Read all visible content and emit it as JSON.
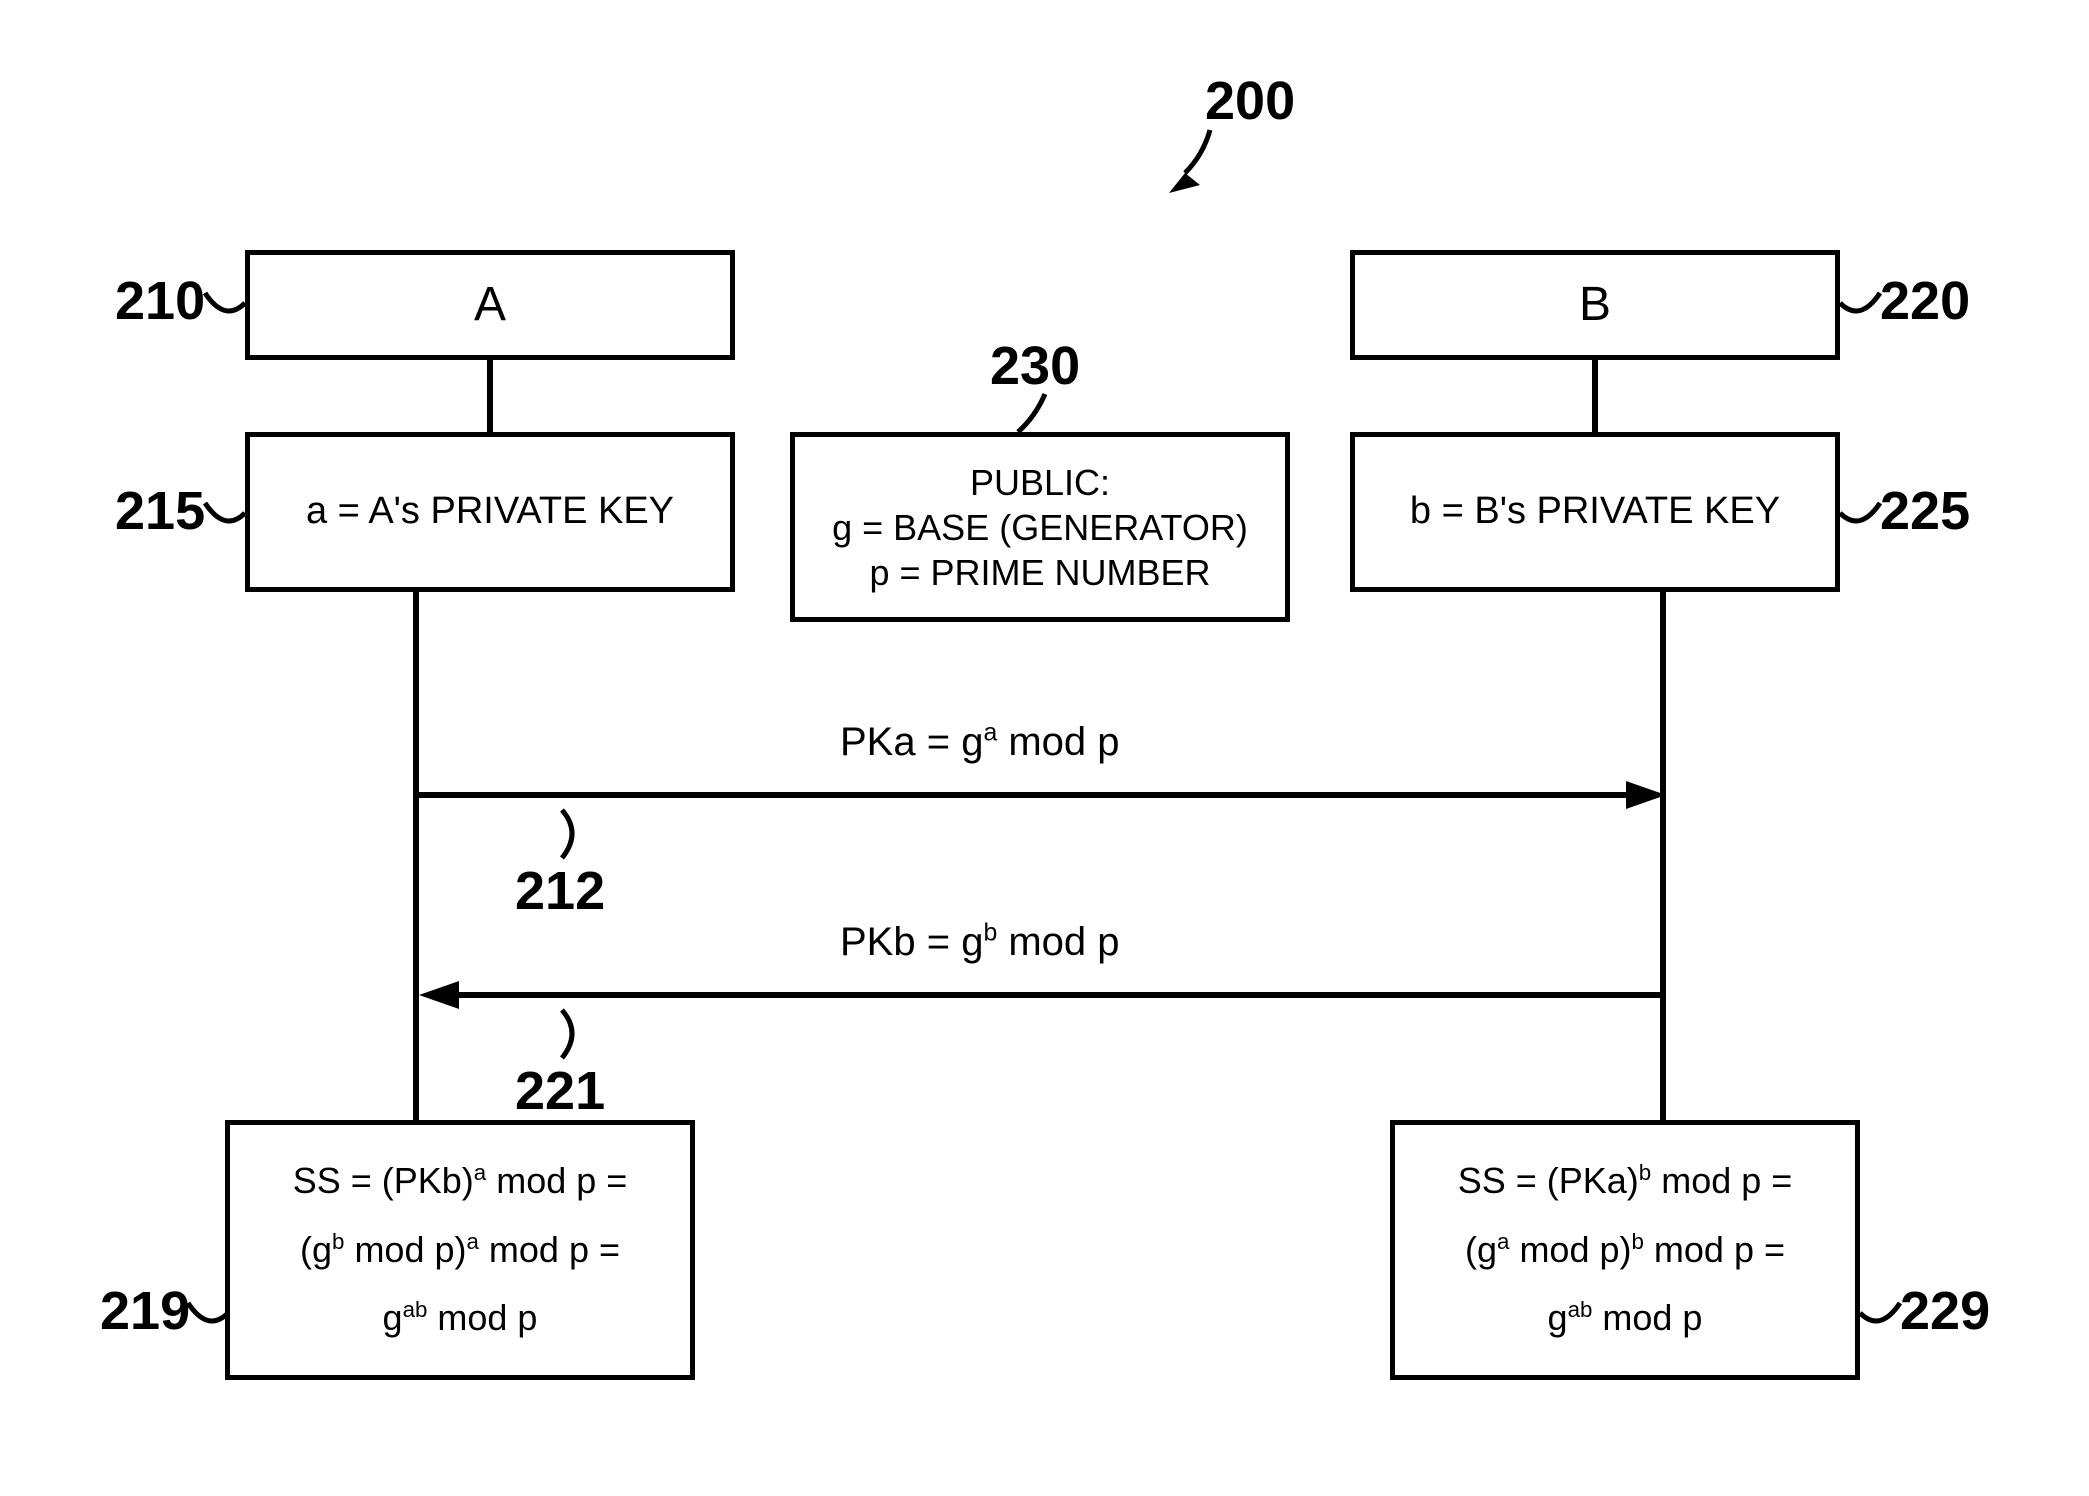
{
  "diagram": {
    "ref_main": "200",
    "partyA": {
      "ref": "210",
      "label": "A"
    },
    "partyB": {
      "ref": "220",
      "label": "B"
    },
    "privA": {
      "ref": "215",
      "text": "a = A's PRIVATE KEY"
    },
    "privB": {
      "ref": "225",
      "text": "b = B's PRIVATE KEY"
    },
    "public": {
      "ref": "230",
      "line1": "PUBLIC:",
      "line2": "g = BASE (GENERATOR)",
      "line3": "p = PRIME NUMBER"
    },
    "msgPKa": {
      "ref": "212",
      "html": "PKa = g<sup>a</sup> mod p"
    },
    "msgPKb": {
      "ref": "221",
      "html": "PKb = g<sup>b</sup> mod p"
    },
    "ssA": {
      "ref": "219",
      "l1": "SS = (PKb)<sup>a</sup> mod p =",
      "l2": "(g<sup>b</sup> mod p)<sup>a</sup> mod p =",
      "l3": "g<sup>ab</sup> mod p"
    },
    "ssB": {
      "ref": "229",
      "l1": "SS = (PKa)<sup>b</sup> mod p =",
      "l2": "(g<sup>a</sup> mod p)<sup>b</sup> mod p =",
      "l3": "g<sup>ab</sup> mod p"
    }
  }
}
